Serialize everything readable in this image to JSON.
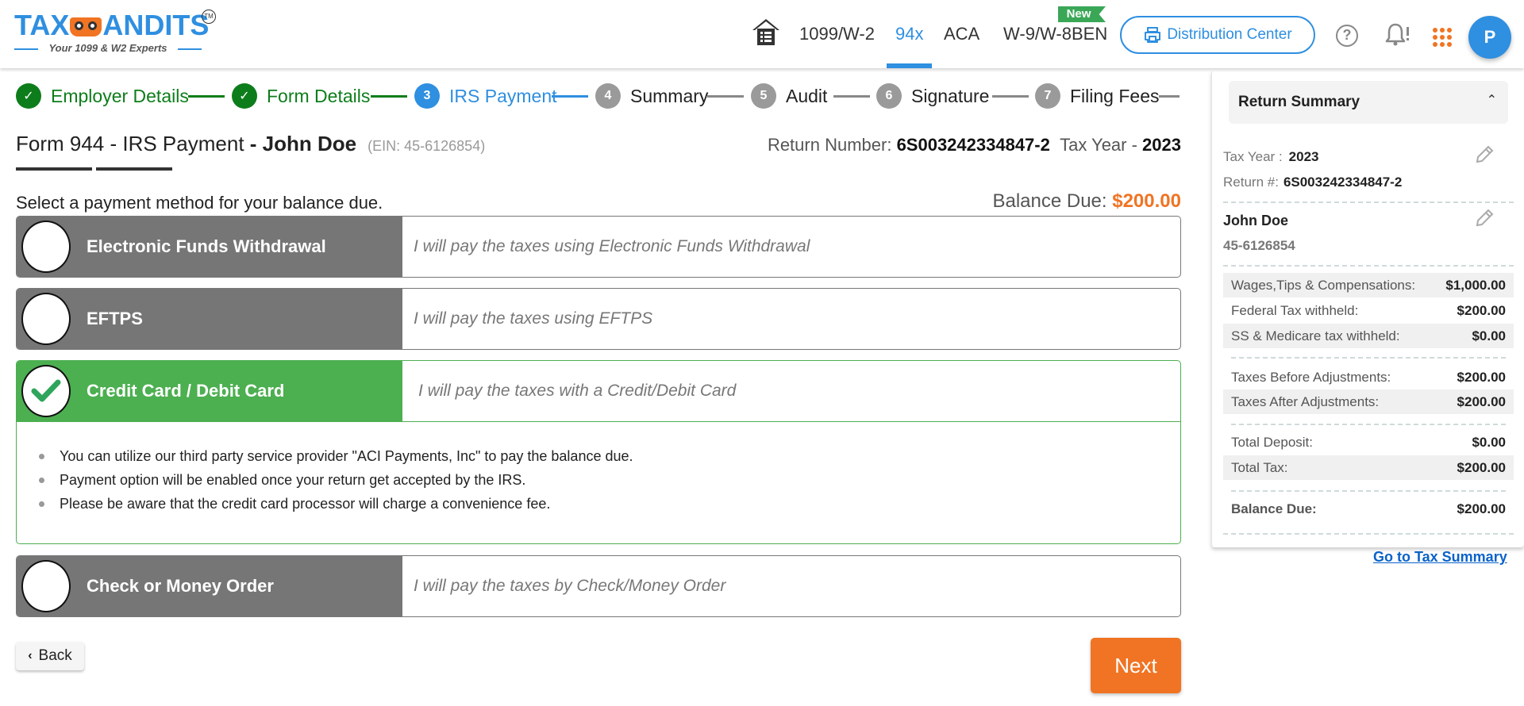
{
  "header": {
    "logo": {
      "brand": "TAX",
      "brand_rest": "ANDITS",
      "tm": "TM",
      "tagline": "Your 1099 & W2 Experts"
    },
    "nav": [
      {
        "label": "1099/W-2",
        "active": false
      },
      {
        "label": "94x",
        "active": true
      },
      {
        "label": "ACA",
        "active": false
      },
      {
        "label": "W-9/W-8BEN",
        "active": false
      }
    ],
    "new_badge": "New",
    "distribution_center": "Distribution Center",
    "help_icon": "?",
    "avatar_initial": "P",
    "colors": {
      "primary": "#2f8fe0",
      "accent": "#f07423",
      "success": "#4caf50",
      "done": "#0d7d1b"
    }
  },
  "stepper": [
    {
      "num": "1",
      "label": "Employer Details",
      "state": "done"
    },
    {
      "num": "2",
      "label": "Form Details",
      "state": "done"
    },
    {
      "num": "3",
      "label": "IRS Payment",
      "state": "current"
    },
    {
      "num": "4",
      "label": "Summary",
      "state": "todo"
    },
    {
      "num": "5",
      "label": "Audit",
      "state": "todo"
    },
    {
      "num": "6",
      "label": "Signature",
      "state": "todo"
    },
    {
      "num": "7",
      "label": "Filing Fees",
      "state": "todo"
    }
  ],
  "page": {
    "title_form": "Form 944 - IRS Payment ",
    "title_name": " - John Doe",
    "ein": "(EIN: 45-6126854)",
    "return_number_label": "Return Number: ",
    "return_number": "6S003242334847-2",
    "tax_year_label": "Tax Year - ",
    "tax_year": "2023",
    "select_label": "Select a payment method for your balance due.",
    "balance_due_label": "Balance Due: ",
    "balance_due": "$200.00"
  },
  "payment_options": [
    {
      "title": "Electronic Funds Withdrawal",
      "desc": "I will pay the taxes using Electronic Funds Withdrawal",
      "selected": false
    },
    {
      "title": "EFTPS",
      "desc": "I will pay the taxes using EFTPS",
      "selected": false
    },
    {
      "title": "Credit Card / Debit Card",
      "desc": "I will pay the taxes with a Credit/Debit Card",
      "selected": true
    },
    {
      "title": "Check or Money Order",
      "desc": "I will pay the taxes by Check/Money Order",
      "selected": false
    }
  ],
  "credit_card_notes": [
    "You can utilize our third party service provider \"ACI Payments, Inc\" to pay the balance due.",
    "Payment option will be enabled once your return get accepted by the IRS.",
    "Please be aware that the credit card processor will charge a convenience fee."
  ],
  "buttons": {
    "back": "Back",
    "next": "Next"
  },
  "sidebar": {
    "title": "Return Summary",
    "tax_year_label": "Tax Year :",
    "tax_year": "2023",
    "return_label": "Return #:",
    "return_number": "6S003242334847-2",
    "employer_name": "John Doe",
    "employer_ein": "45-6126854",
    "rows_group1": [
      {
        "label": "Wages,Tips & Compensations:",
        "value": "$1,000.00"
      },
      {
        "label": "Federal Tax withheld:",
        "value": "$200.00"
      },
      {
        "label": "SS & Medicare tax withheld:",
        "value": "$0.00"
      }
    ],
    "rows_group2": [
      {
        "label": "Taxes Before Adjustments:",
        "value": "$200.00"
      },
      {
        "label": "Taxes After Adjustments:",
        "value": "$200.00"
      }
    ],
    "rows_group3": [
      {
        "label": "Total Deposit:",
        "value": "$0.00"
      },
      {
        "label": "Total Tax:",
        "value": "$200.00"
      }
    ],
    "balance_due_label": "Balance Due:",
    "balance_due": "$200.00",
    "tax_summary_link": "Go to Tax Summary"
  }
}
